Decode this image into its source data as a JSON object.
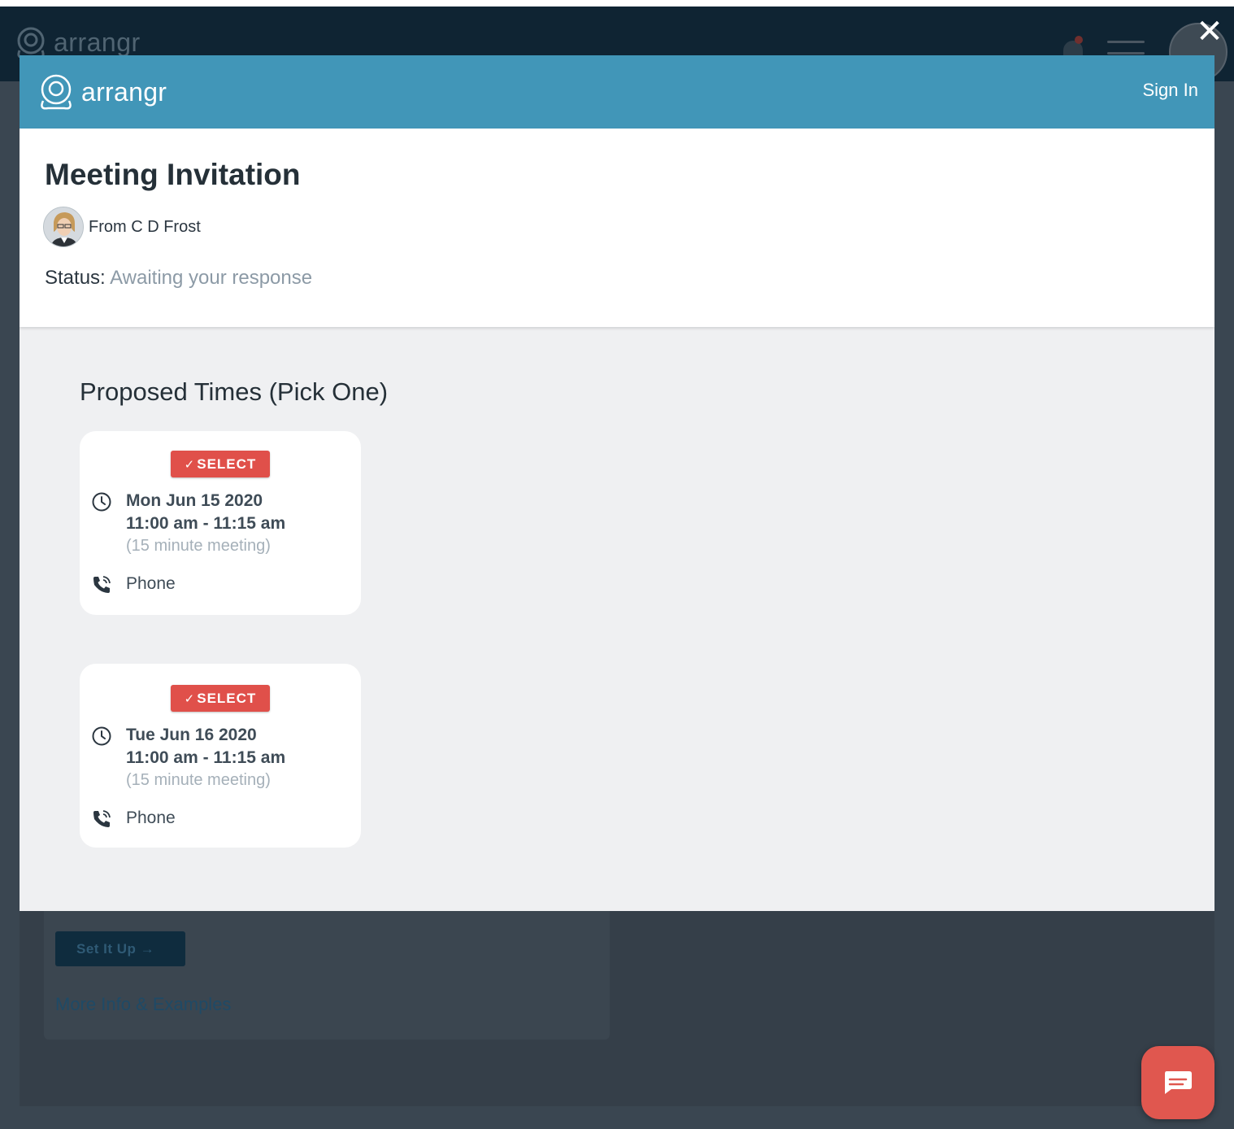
{
  "background": {
    "logo_text": "arrangr",
    "setup_button": "Set It Up →",
    "more_info_link": "More Info & Examples"
  },
  "modal": {
    "close_icon": "close-icon",
    "header": {
      "brand": "arrangr",
      "sign_in": "Sign In"
    },
    "title": "Meeting Invitation",
    "from": "From C D Frost",
    "status_label": "Status:",
    "status_value": "Awaiting your response",
    "proposed_title": "Proposed Times (Pick One)",
    "times": [
      {
        "select_label": "SELECT",
        "date": "Mon Jun 15 2020",
        "range": "11:00 am - 11:15 am",
        "duration": "(15 minute meeting)",
        "method": "Phone"
      },
      {
        "select_label": "SELECT",
        "date": "Tue Jun 16 2020",
        "range": "11:00 am - 11:15 am",
        "duration": "(15 minute meeting)",
        "method": "Phone"
      }
    ]
  },
  "colors": {
    "header_blue": "#4196b8",
    "select_red": "#e0504a",
    "chat_fab": "#e0574f",
    "status_gray": "#8c9aa6"
  }
}
